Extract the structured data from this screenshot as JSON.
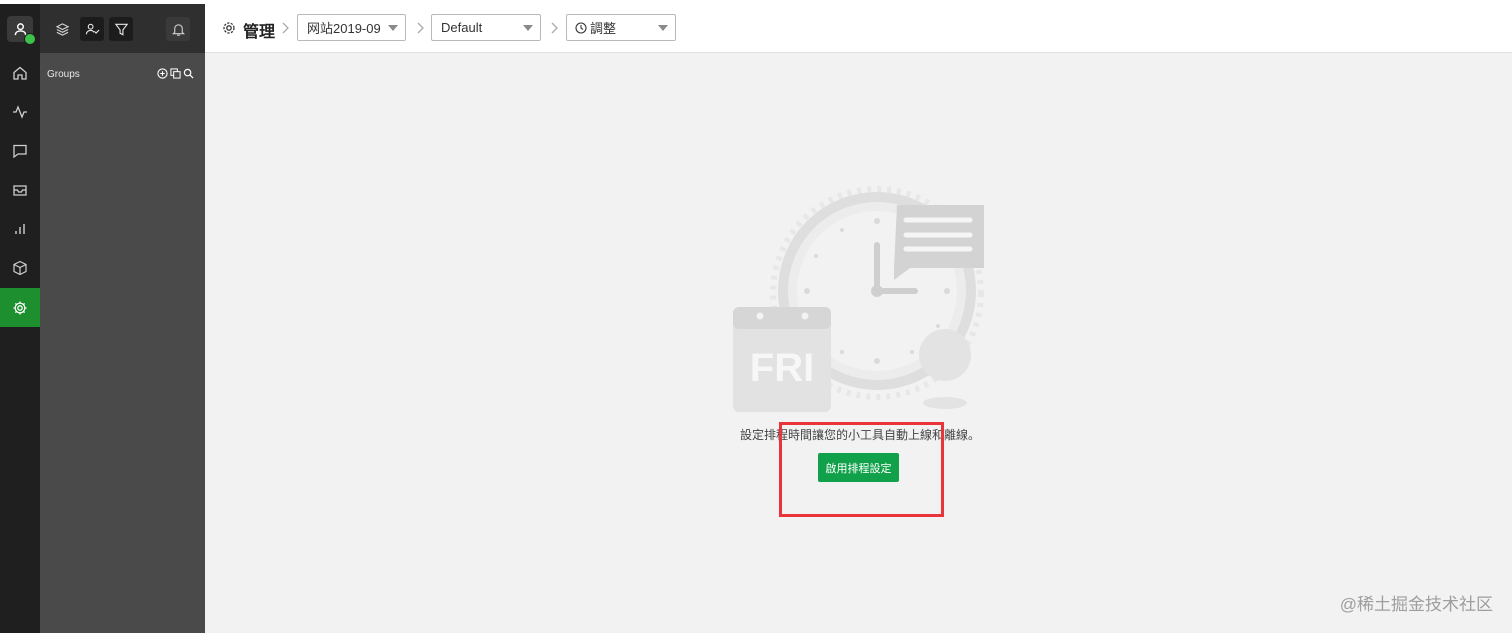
{
  "header": {
    "title": "管理",
    "site_select": "网站2019-09",
    "layout_select": "Default",
    "schedule_select": "調整"
  },
  "panel": {
    "groups_label": "Groups"
  },
  "main": {
    "message": "設定排程時間讓您的小工具自動上線和離線。",
    "enable_button": "啟用排程設定",
    "calendar_text": "FRI"
  },
  "watermark": "@稀土掘金技术社区",
  "colors": {
    "active_green": "#1e8f2e",
    "button_green": "#12a14b",
    "highlight_red": "#e8343a"
  }
}
